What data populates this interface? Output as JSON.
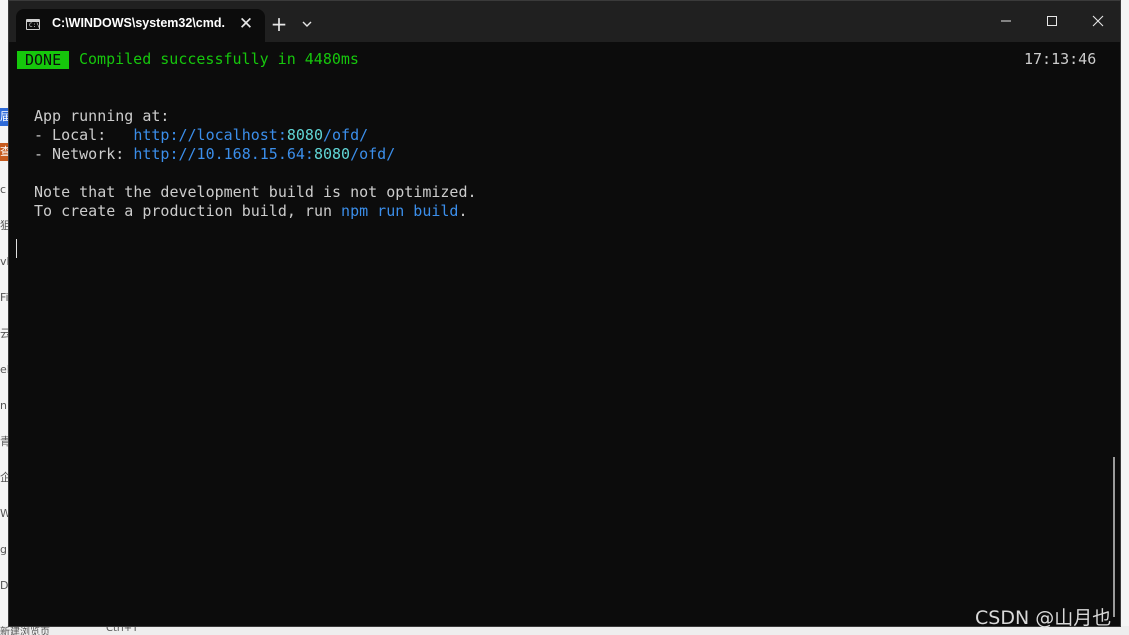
{
  "window": {
    "tab_title": "C:\\WINDOWS\\system32\\cmd.",
    "tab_icon": "cmd-icon"
  },
  "terminal": {
    "done_badge": "DONE",
    "done_message": "Compiled successfully in 4480ms",
    "timestamp": "17:13:46",
    "app_running": "App running at:",
    "local_label": "- Local:   ",
    "local_url_prefix": "http://localhost:",
    "local_port": "8080",
    "local_path": "/ofd/",
    "network_label": "- Network: ",
    "network_url_prefix": "http://10.168.15.64:",
    "network_port": "8080",
    "network_path": "/ofd/",
    "note_line": "Note that the development build is not optimized.",
    "prod_prefix": "To create a production build, run ",
    "prod_cmd": "npm run build",
    "prod_suffix": "."
  },
  "watermark": "CSDN @山月也",
  "background": {
    "left_fragments": [
      "届",
      "查",
      "c",
      "狙",
      "vb",
      "Fi",
      "云",
      "el",
      "n",
      "青",
      "企",
      "W",
      "gi",
      "D"
    ],
    "bottom_left": "新建浏览页",
    "bottom_right": "Ctrl+T"
  },
  "colors": {
    "terminal_bg": "#0c0c0c",
    "titlebar_bg": "#202020",
    "success_green": "#16c60c",
    "link_blue": "#3b8eea",
    "port_cyan": "#61d6d6",
    "text_gray": "#cccccc"
  }
}
